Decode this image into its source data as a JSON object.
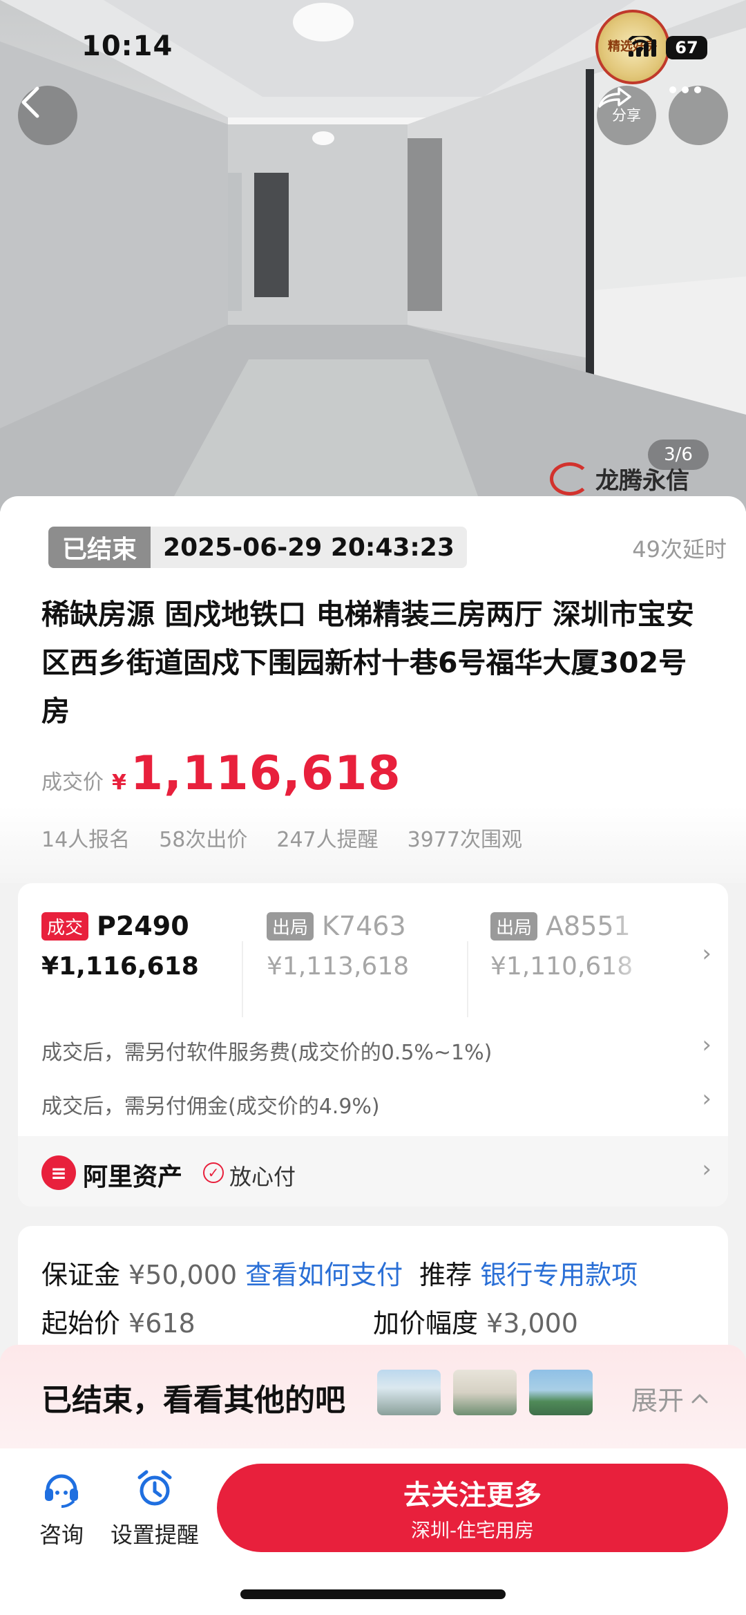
{
  "status_bar": {
    "time": "10:14",
    "battery": "67"
  },
  "hero": {
    "share_label": "分享",
    "photo_counter": "3/6",
    "watermark": "龙腾永信",
    "badge_text": "精选好房"
  },
  "auction": {
    "status_tag": "已结束",
    "end_time": "2025-06-29 20:43:23",
    "delay_count": "49次延时",
    "title": "稀缺房源 固戍地铁口 电梯精装三房两厅 深圳市宝安区西乡街道固戍下围园新村十巷6号福华大厦302号房",
    "price_label": "成交价",
    "price_currency": "¥",
    "price_value": "1,116,618",
    "stats": [
      "14人报名",
      "58次出价",
      "247人提醒",
      "3977次围观"
    ]
  },
  "bids": {
    "bidders": [
      {
        "tag": "成交",
        "code": "P2490",
        "amount": "¥1,116,618"
      },
      {
        "tag": "出局",
        "code": "K7463",
        "amount": "¥1,113,618"
      },
      {
        "tag": "出局",
        "code": "A8551",
        "amount": "¥1,110,618"
      }
    ],
    "fee_service": "成交后，需另付软件服务费(成交价的0.5%~1%)",
    "fee_commission": "成交后，需另付佣金(成交价的4.9%)",
    "ali_name": "阿里资产",
    "secure_label": "放心付"
  },
  "deposit": {
    "deposit_label": "保证金",
    "deposit_value": "¥50,000",
    "how_to_pay": "查看如何支付",
    "recommend_label": "推荐",
    "bank_account": "银行专用款项",
    "start_price_label": "起始价",
    "start_price_value": "¥618",
    "increment_label": "加价幅度",
    "increment_value": "¥3,000"
  },
  "ended_banner": {
    "text": "已结束，看看其他的吧",
    "expand_label": "展开"
  },
  "bottom_bar": {
    "consult_label": "咨询",
    "remind_label": "设置提醒",
    "cta_main": "去关注更多",
    "cta_sub": "深圳-住宅用房"
  },
  "colors": {
    "accent": "#e8203c",
    "link": "#2a6fd6",
    "muted": "#999999"
  }
}
